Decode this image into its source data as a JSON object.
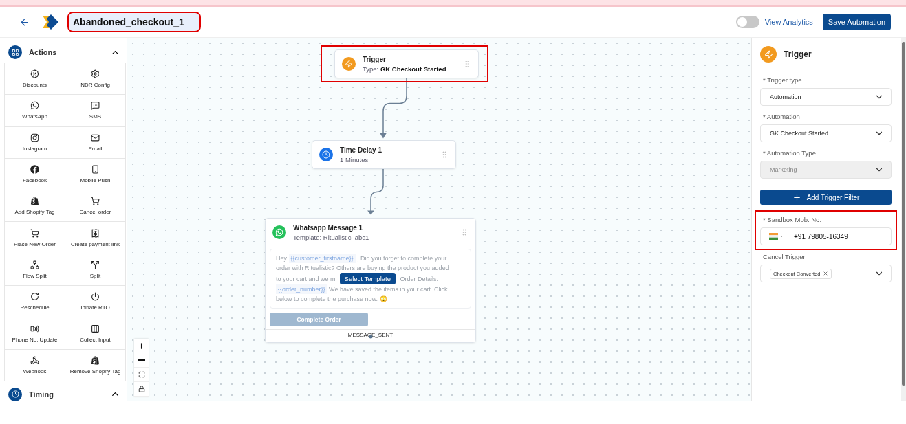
{
  "header": {
    "title": "Abandoned_checkout_1",
    "title_highlighted": true,
    "analytics_toggle": {
      "label": "View Analytics",
      "on": false
    },
    "save_button": "Save Automation"
  },
  "sidebar": {
    "sections": [
      {
        "title": "Actions",
        "expanded": true,
        "items": [
          "Discounts",
          "NDR Config",
          "WhatsApp",
          "SMS",
          "Instagram",
          "Email",
          "Facebook",
          "Mobile Push",
          "Add Shopify Tag",
          "Cancel order",
          "Place New Order",
          "Create payment link",
          "Flow Split",
          "Split",
          "Reschedule",
          "Initiate RTO",
          "Phone No. Update",
          "Collect Input",
          "Webhook",
          "Remove Shopify Tag"
        ]
      },
      {
        "title": "Timing",
        "expanded": true
      }
    ]
  },
  "canvas": {
    "nodes": [
      {
        "kind": "trigger",
        "title": "Trigger",
        "subtitle_label": "Type:",
        "subtitle": "GK Checkout Started",
        "highlighted": true
      },
      {
        "kind": "delay",
        "title": "Time Delay 1",
        "subtitle": "1 Minutes"
      },
      {
        "kind": "whatsapp",
        "title": "Whatsapp Message 1",
        "subtitle": "Template: Ritualistic_abc1",
        "message": [
          [
            {
              "t": "Hey "
            },
            {
              "v": "{{customer_firstname}}"
            },
            {
              "t": " , Did you forget to complete your"
            }
          ],
          [
            {
              "t": "order with Ritualistic? Others are buying the product you added"
            }
          ],
          [
            {
              "t": "to your cart and we mi"
            },
            {
              "button": "Select Template"
            },
            {
              "t": " Order Details:"
            }
          ],
          [
            {
              "v": "{{order_number}}"
            },
            {
              "t": " We have saved the items in your cart. Click"
            }
          ],
          [
            {
              "t": "below to complete the purchase now. 😳"
            }
          ]
        ],
        "cta": "Complete Order",
        "footer": "MESSAGE_SENT"
      }
    ]
  },
  "panel": {
    "title": "Trigger",
    "fields": [
      {
        "kind": "select",
        "label": "* Trigger type",
        "value": "Automation",
        "disabled": false
      },
      {
        "kind": "select",
        "label": "* Automation",
        "value": "GK Checkout Started",
        "disabled": false
      },
      {
        "kind": "select",
        "label": "* Automation Type",
        "value": "Marketing",
        "disabled": true
      },
      {
        "kind": "button",
        "label": "Add Trigger Filter"
      },
      {
        "kind": "phone",
        "label": "* Sandbox Mob. No.",
        "value": "+91 79805-16349",
        "highlighted": true
      },
      {
        "kind": "tags",
        "label": "Cancel Trigger",
        "tags": [
          "Checkout Converted"
        ]
      }
    ]
  }
}
